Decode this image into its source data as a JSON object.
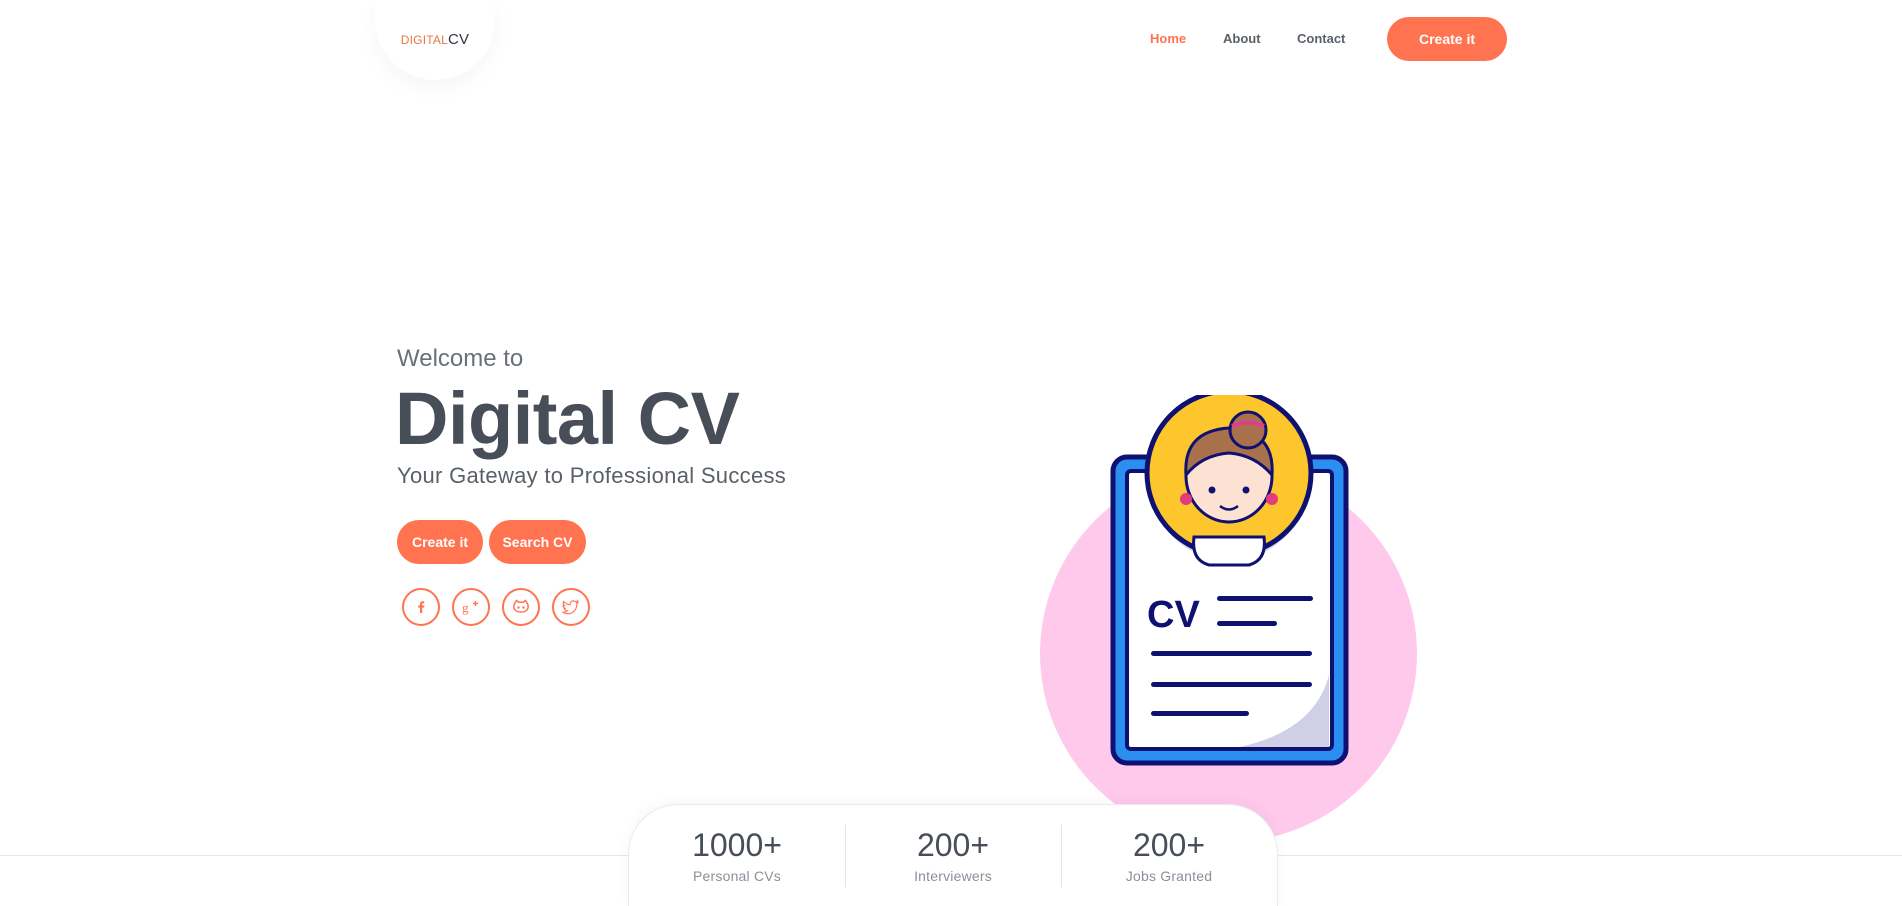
{
  "brand": {
    "part1": "DIGITAL",
    "part2": "CV"
  },
  "nav": {
    "items": [
      {
        "label": "Home",
        "active": true
      },
      {
        "label": "About",
        "active": false
      },
      {
        "label": "Contact",
        "active": false
      }
    ],
    "cta_label": "Create it"
  },
  "hero": {
    "welcome": "Welcome to",
    "title": "Digital CV",
    "tagline": "Your Gateway to Professional Success",
    "buttons": {
      "create": "Create it",
      "search": "Search CV"
    },
    "social_icons": [
      "facebook-icon",
      "google-plus-icon",
      "github-icon",
      "twitter-icon"
    ],
    "illustration": {
      "badge_text": "CV"
    }
  },
  "stats": [
    {
      "value": "1000+",
      "label": "Personal CVs"
    },
    {
      "value": "200+",
      "label": "Interviewers"
    },
    {
      "value": "200+",
      "label": "Jobs Granted"
    }
  ],
  "colors": {
    "accent": "#ff7350",
    "text_dark": "#474e57",
    "blob_pink": "#ffc9eb",
    "avatar_yellow": "#fdc62c",
    "clipboard_blue": "#2a8ff0",
    "navy": "#0f1172"
  }
}
